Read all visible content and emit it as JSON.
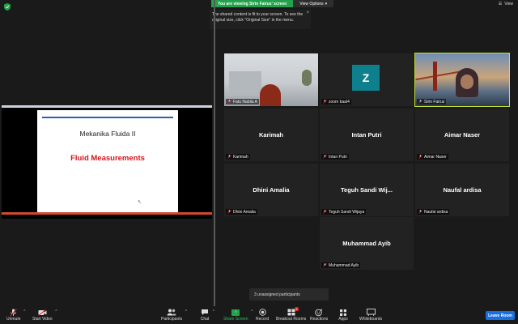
{
  "topbar": {
    "share_status": "You are viewing Sirin Fairus' screen",
    "view_options": "View Options",
    "view_label": "View",
    "tooltip": "The shared content is fit to your screen. To see the original size, click \"Original Size\" in the menu."
  },
  "shared_screen": {
    "slide_title": "Mekanika Fluida II",
    "slide_subtitle": "Fluid Measurements"
  },
  "participants": [
    {
      "label": "Fatu Nabila A",
      "display": "",
      "kind": "video-room"
    },
    {
      "label": "zoom baal4",
      "display": "Z",
      "kind": "avatar",
      "avatar_color": "#0e7f8c"
    },
    {
      "label": "Sirin Fairus",
      "display": "",
      "kind": "video-bridge",
      "active": true
    },
    {
      "label": "Karimah",
      "display": "Karimah",
      "kind": "name"
    },
    {
      "label": "Intan Putri",
      "display": "Intan Putri",
      "kind": "name"
    },
    {
      "label": "Aimar Naser",
      "display": "Aimar Naser",
      "kind": "name"
    },
    {
      "label": "Dhini Amalia",
      "display": "Dhini Amalia",
      "kind": "name"
    },
    {
      "label": "Teguh Sandi Wijaya",
      "display": "Teguh Sandi Wij...",
      "kind": "name"
    },
    {
      "label": "Naufal ardisa",
      "display": "Naufal ardisa",
      "kind": "name"
    },
    {
      "label": "Muhammad Ayib",
      "display": "Muhammad Ayib",
      "kind": "name"
    }
  ],
  "unassigned": "3 unassigned participants",
  "toolbar": {
    "unmute": "Unmute",
    "start_video": "Start Video",
    "participants": "Participants",
    "participants_count": "",
    "chat": "Chat",
    "share_screen": "Share Screen",
    "record": "Record",
    "breakout_rooms": "Breakout Rooms",
    "breakout_badge": "6",
    "reactions": "Reactions",
    "apps": "Apps",
    "whiteboards": "Whiteboards",
    "leave": "Leave Room"
  },
  "colors": {
    "accent_green": "#23a14b",
    "active_speaker": "#c6e034",
    "leave_blue": "#1a6fe0",
    "slide_red": "#d3131a"
  }
}
